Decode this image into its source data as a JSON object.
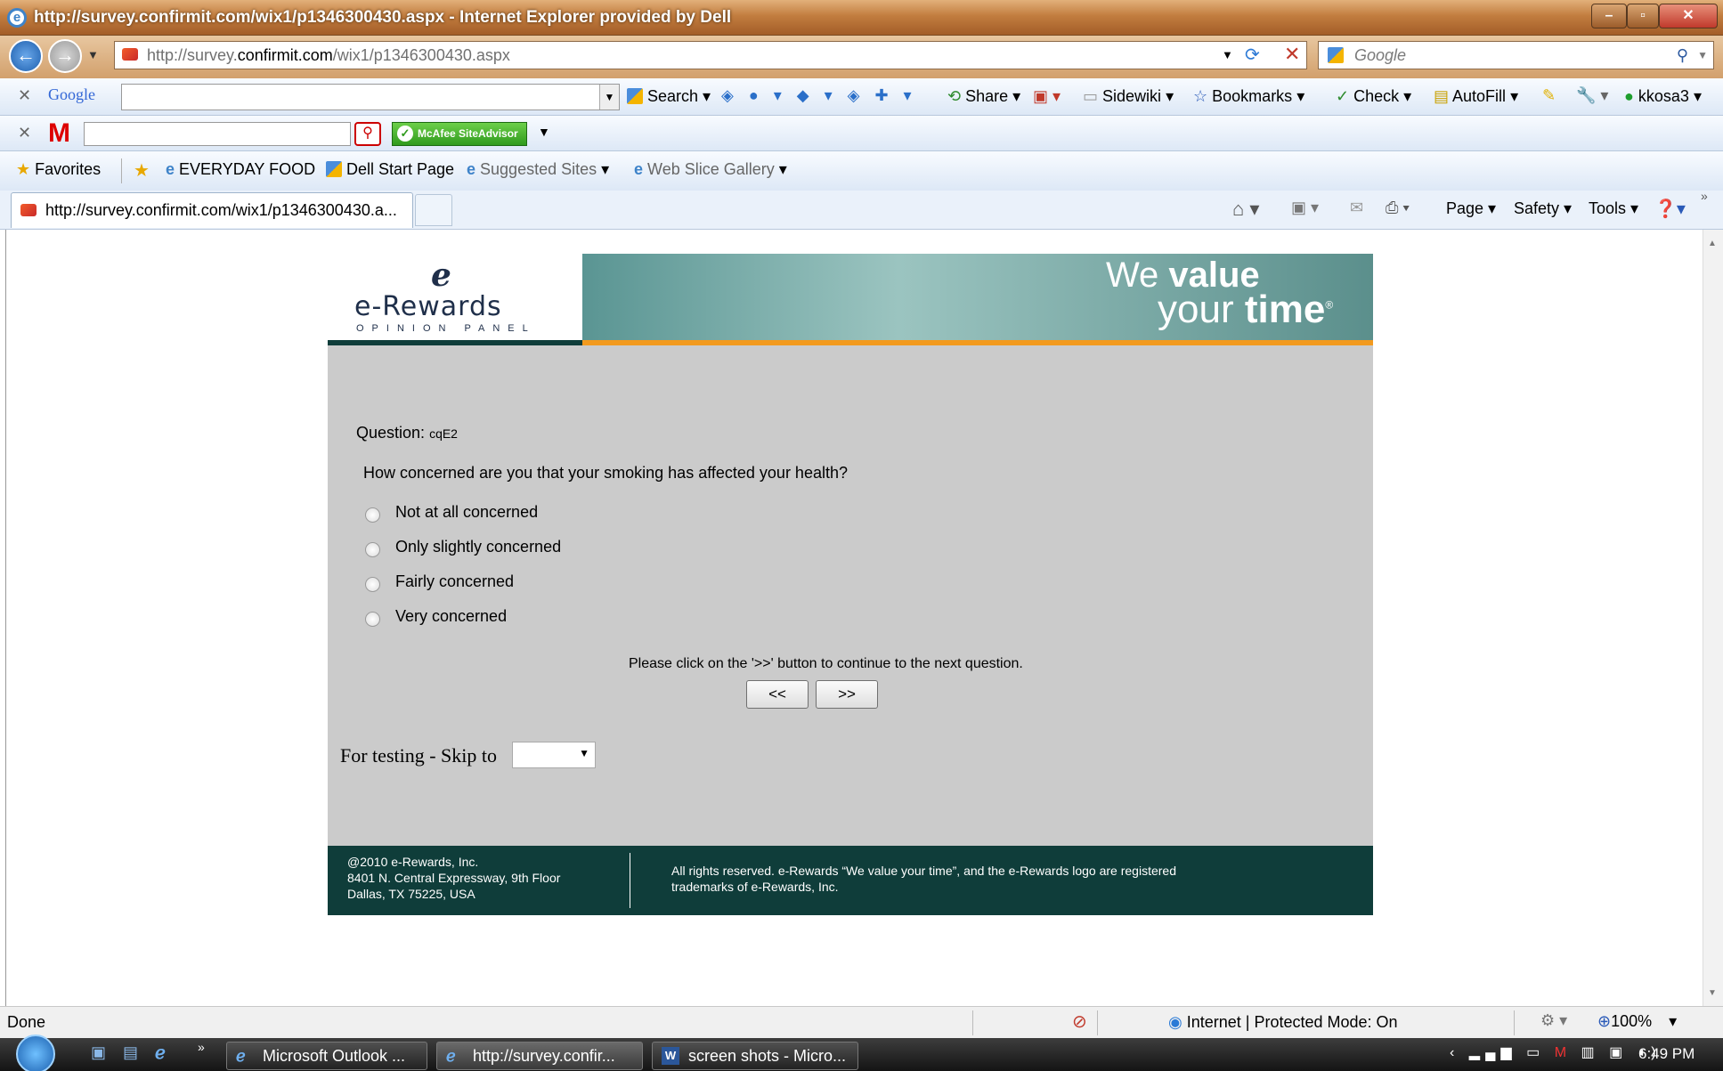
{
  "window": {
    "title": "http://survey.confirmit.com/wix1/p1346300430.aspx - Internet Explorer provided by Dell"
  },
  "address_bar": {
    "url_prefix": "http://survey.",
    "url_domain": "confirmit.com",
    "url_path": "/wix1/p1346300430.aspx",
    "search_placeholder": "Google"
  },
  "google_toolbar": {
    "logo": "Google",
    "search_label": "Search",
    "share_label": "Share",
    "sidewiki_label": "Sidewiki",
    "bookmarks_label": "Bookmarks",
    "check_label": "Check",
    "autofill_label": "AutoFill",
    "account": "kkosa3"
  },
  "mcafee_toolbar": {
    "brand": "M",
    "siteadvisor_label": "McAfee SiteAdvisor"
  },
  "favorites_bar": {
    "favorites_label": "Favorites",
    "items": [
      "EVERYDAY FOOD",
      "Dell Start Page",
      "Suggested Sites",
      "Web Slice Gallery"
    ]
  },
  "tab": {
    "title": "http://survey.confirmit.com/wix1/p1346300430.a..."
  },
  "command_bar": {
    "page": "Page",
    "safety": "Safety",
    "tools": "Tools"
  },
  "banner": {
    "brand": "e-Rewards",
    "tagline_sub": "OPINION PANEL",
    "slogan_line1_a": "We ",
    "slogan_line1_b": "value",
    "slogan_line2_a": "your ",
    "slogan_line2_b": "time"
  },
  "survey": {
    "question_label": "Question:",
    "question_id": "cqE2",
    "question_text": "How concerned are you that your smoking has affected your health?",
    "options": [
      "Not at all concerned",
      "Only slightly concerned",
      "Fairly concerned",
      "Very concerned"
    ],
    "instruction": "Please click on the '>>' button to continue to the next question.",
    "back_label": "<<",
    "next_label": ">>",
    "skip_label": "For testing - Skip to"
  },
  "footer": {
    "copyright": "@2010 e-Rewards, Inc.",
    "address1": "8401 N. Central Expressway, 9th Floor",
    "address2": "Dallas, TX 75225, USA",
    "legal_line1": "All rights reserved. e-Rewards “We value your time”, and the e-Rewards logo are registered",
    "legal_line2": "trademarks of e-Rewards, Inc."
  },
  "status_bar": {
    "status": "Done",
    "zone": "Internet | Protected Mode: On",
    "zoom": "100%"
  },
  "taskbar": {
    "tasks": [
      "Microsoft Outlook ...",
      "http://survey.confir...",
      "screen shots - Micro..."
    ],
    "clock": "6:49 PM"
  },
  "colors": {
    "survey_bg": "#cbcbcb",
    "footer_bg": "#0f3d3a",
    "accent_orange": "#f29a1e",
    "banner_teal": "#5a9593"
  }
}
